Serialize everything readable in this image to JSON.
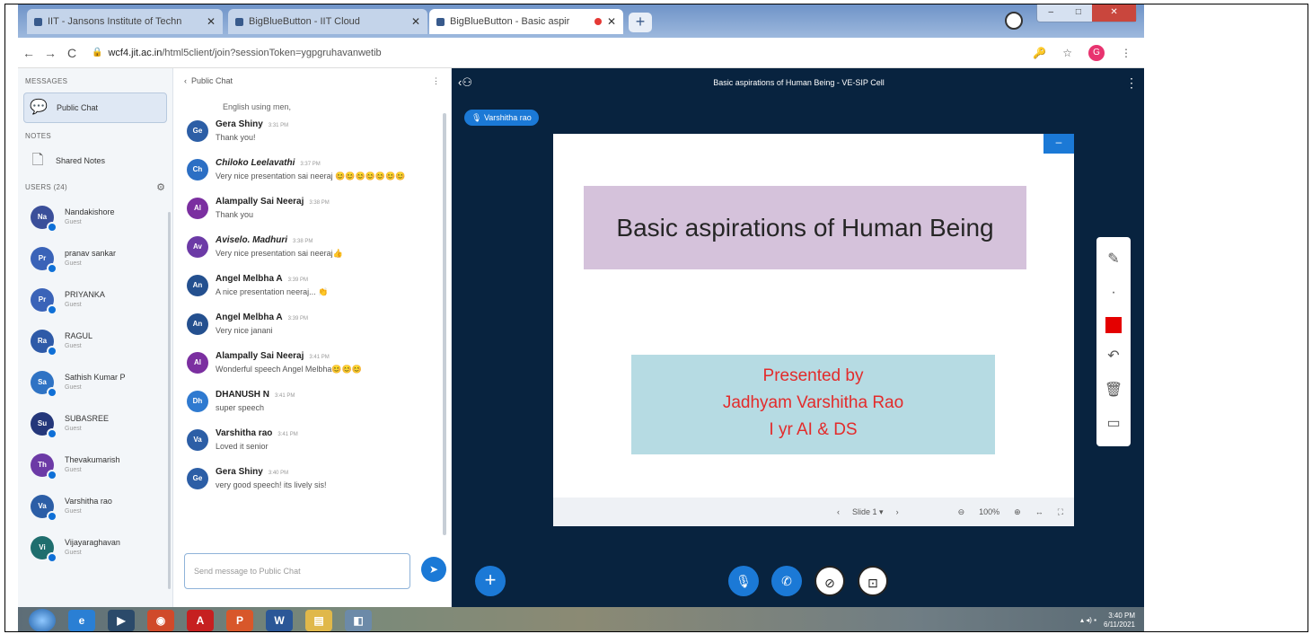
{
  "browser": {
    "tabs": [
      {
        "label": "IIT - Jansons Institute of Techn",
        "active": false
      },
      {
        "label": "BigBlueButton - IIT Cloud",
        "active": false
      },
      {
        "label": "BigBlueButton - Basic aspir",
        "active": true
      }
    ],
    "url_host": "wcf4.jit.ac.in",
    "url_path": "/html5client/join?sessionToken=ygpgruhavanwetib",
    "profile_initial": "G"
  },
  "left": {
    "messages_label": "MESSAGES",
    "public_chat": "Public Chat",
    "notes_label": "NOTES",
    "shared_notes": "Shared Notes",
    "users_label": "USERS (24)",
    "users": [
      {
        "initials": "Na",
        "name": "Nandakishore",
        "role": "Guest",
        "color": "#3b4f9a"
      },
      {
        "initials": "Pr",
        "name": "pranav sankar",
        "role": "Guest",
        "color": "#3a63b8"
      },
      {
        "initials": "Pr",
        "name": "PRIYANKA",
        "role": "Guest",
        "color": "#3a63b8"
      },
      {
        "initials": "Ra",
        "name": "RAGUL",
        "role": "Guest",
        "color": "#2e5aa8"
      },
      {
        "initials": "Sa",
        "name": "Sathish Kumar P",
        "role": "Guest",
        "color": "#2f73c4"
      },
      {
        "initials": "Su",
        "name": "SUBASREE",
        "role": "Guest",
        "color": "#24377a"
      },
      {
        "initials": "Th",
        "name": "Thevakumarish",
        "role": "Guest",
        "color": "#6c3aa6"
      },
      {
        "initials": "Va",
        "name": "Varshitha rao",
        "role": "Guest",
        "color": "#2c5ea6"
      },
      {
        "initials": "Vi",
        "name": "Vijayaraghavan",
        "role": "Guest",
        "color": "#1f6e6e"
      }
    ]
  },
  "chat": {
    "title": "Public Chat",
    "truncated_text": "English using men,",
    "messages": [
      {
        "initials": "Ge",
        "color": "#2c5ea6",
        "sender": "Gera Shiny",
        "italic": false,
        "time": "3:31 PM",
        "text": "Thank you!"
      },
      {
        "initials": "Ch",
        "color": "#2c6fc4",
        "sender": "Chiloko Leelavathi",
        "italic": true,
        "time": "3:37 PM",
        "text": "Very nice presentation sai neeraj 😊😊😊😊😊😊😊"
      },
      {
        "initials": "Al",
        "color": "#7b2fa0",
        "sender": "Alampally Sai Neeraj",
        "italic": false,
        "time": "3:38 PM",
        "text": "Thank you"
      },
      {
        "initials": "Av",
        "color": "#6c3aa6",
        "sender": "Aviselo. Madhuri",
        "italic": true,
        "time": "3:38 PM",
        "text": "Very nice presentation sai neeraj👍"
      },
      {
        "initials": "An",
        "color": "#24508f",
        "sender": "Angel Melbha A",
        "italic": false,
        "time": "3:39 PM",
        "text": "A nice presentation neeraj... 👏"
      },
      {
        "initials": "An",
        "color": "#24508f",
        "sender": "Angel Melbha A",
        "italic": false,
        "time": "3:39 PM",
        "text": "Very nice janani"
      },
      {
        "initials": "Al",
        "color": "#7b2fa0",
        "sender": "Alampally Sai Neeraj",
        "italic": false,
        "time": "3:41 PM",
        "text": "Wonderful speech Angel Melbha😊😊😊"
      },
      {
        "initials": "Dh",
        "color": "#2f7ad0",
        "sender": "DHANUSH N",
        "italic": false,
        "time": "3:41 PM",
        "text": "super speech"
      },
      {
        "initials": "Va",
        "color": "#2c5ea6",
        "sender": "Varshitha rao",
        "italic": false,
        "time": "3:41 PM",
        "text": "Loved it senior"
      },
      {
        "initials": "Ge",
        "color": "#2c5ea6",
        "sender": "Gera Shiny",
        "italic": false,
        "time": "3:40 PM",
        "text": "very good speech! its lively sis!"
      }
    ],
    "input_placeholder": "Send message to Public Chat"
  },
  "presentation": {
    "title": "Basic aspirations of Human Being - VE-SIP Cell",
    "talking": "Varshitha rao",
    "slide_title": "Basic aspirations of Human Being",
    "slide_lines": [
      "Presented by",
      "Jadhyam Varshitha Rao",
      "I yr AI & DS"
    ],
    "slide_selector": "Slide 1",
    "zoom": "100%"
  },
  "taskbar": {
    "icons": [
      {
        "name": "ie-icon",
        "label": "e",
        "color": "#2a7fd4"
      },
      {
        "name": "media-icon",
        "label": "▶",
        "color": "#2b4a6a"
      },
      {
        "name": "chrome-icon",
        "label": "◉",
        "color": "#d04a2a"
      },
      {
        "name": "acrobat-icon",
        "label": "A",
        "color": "#c62020"
      },
      {
        "name": "powerpoint-icon",
        "label": "P",
        "color": "#d8572a"
      },
      {
        "name": "word-icon",
        "label": "W",
        "color": "#2b5797"
      },
      {
        "name": "folder-icon",
        "label": "▤",
        "color": "#e0b84a"
      },
      {
        "name": "app-icon",
        "label": "◧",
        "color": "#6c8aa8"
      }
    ],
    "time": "3:40 PM",
    "date": "6/11/2021"
  }
}
